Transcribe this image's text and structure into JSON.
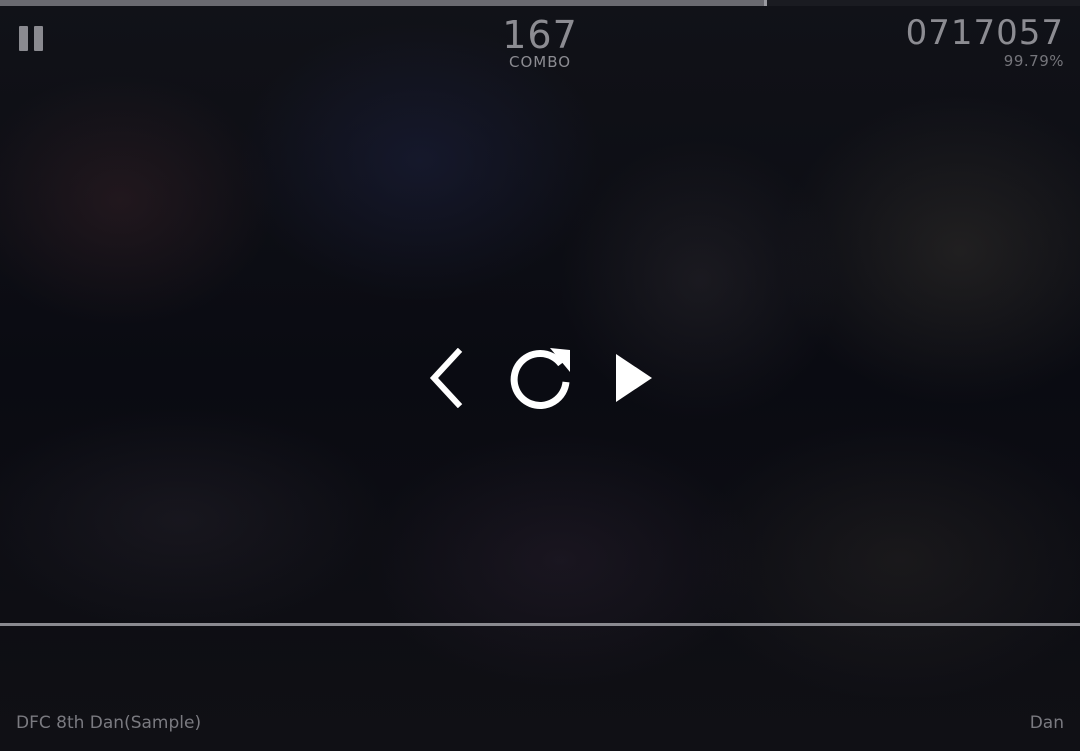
{
  "progress": {
    "fraction": 0.71
  },
  "hud": {
    "combo_value": "167",
    "combo_label": "COMBO",
    "score_value": "0717057",
    "accuracy": "99.79%"
  },
  "controls": {
    "back_icon": "chevron-left-icon",
    "retry_icon": "retry-icon",
    "resume_icon": "play-icon"
  },
  "footer": {
    "song_title": "DFC 8th Dan(Sample)",
    "difficulty": "Dan"
  },
  "colors": {
    "hud_text": "#8c8c92",
    "icon": "#ffffff",
    "progress": "#6a6a70",
    "judgement_line": "#8a8a90"
  }
}
